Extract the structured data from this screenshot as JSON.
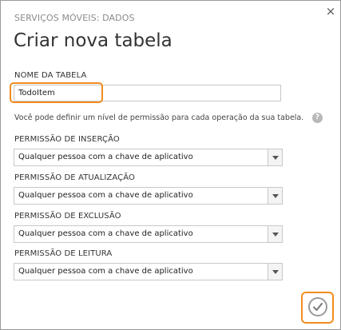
{
  "dialog": {
    "subtitle": "SERVIÇOS MÓVEIS: DADOS",
    "title": "Criar nova tabela",
    "close_icon": "close-icon",
    "close_glyph": "×"
  },
  "table_name": {
    "label": "NOME DA TABELA",
    "value": "TodoItem"
  },
  "info": {
    "text": "Você pode definir um nível de permissão para cada operação da sua tabela.",
    "icon": "help-icon",
    "icon_glyph": "?"
  },
  "permissions": [
    {
      "label": "PERMISSÃO DE INSERÇÃO",
      "value": "Qualquer pessoa com a chave de aplicativo"
    },
    {
      "label": "PERMISSÃO DE ATUALIZAÇÃO",
      "value": "Qualquer pessoa com a chave de aplicativo"
    },
    {
      "label": "PERMISSÃO DE EXCLUSÃO",
      "value": "Qualquer pessoa com a chave de aplicativo"
    },
    {
      "label": "PERMISSÃO DE LEITURA",
      "value": "Qualquer pessoa com a chave de aplicativo"
    }
  ],
  "footer": {
    "ok_icon": "checkmark-icon"
  },
  "colors": {
    "highlight": "#f28c1e",
    "border": "#c8c8c8"
  }
}
